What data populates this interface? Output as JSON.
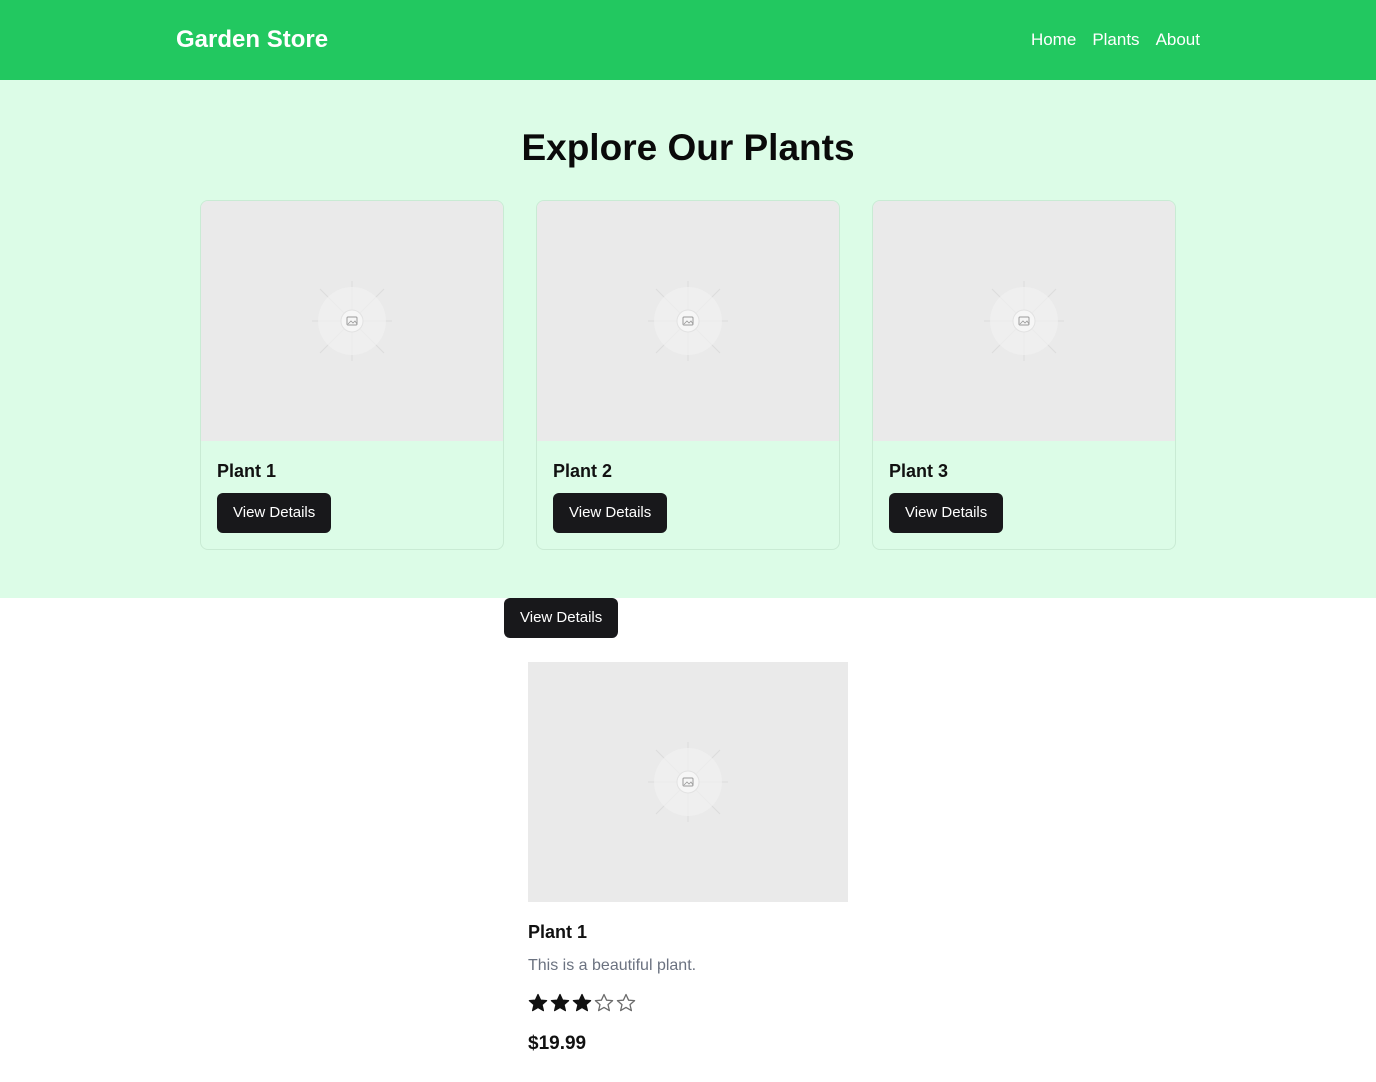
{
  "header": {
    "brand": "Garden Store",
    "nav": [
      "Home",
      "Plants",
      "About"
    ],
    "color": "#22c860"
  },
  "hero": {
    "title": "Explore Our Plants",
    "background": "#dcfce7",
    "cards": [
      {
        "title": "Plant 1",
        "button": "View Details",
        "image_icon": "image-placeholder-icon"
      },
      {
        "title": "Plant 2",
        "button": "View Details",
        "image_icon": "image-placeholder-icon"
      },
      {
        "title": "Plant 3",
        "button": "View Details",
        "image_icon": "image-placeholder-icon"
      }
    ]
  },
  "floating_button": "View Details",
  "detail": {
    "title": "Plant 1",
    "description": "This is a beautiful plant.",
    "rating": 3,
    "rating_max": 5,
    "price": "$19.99"
  }
}
